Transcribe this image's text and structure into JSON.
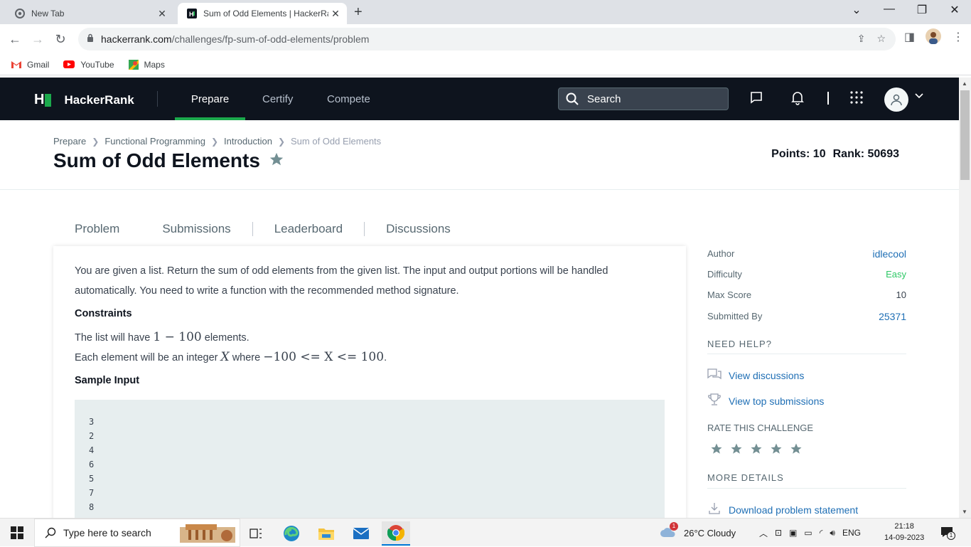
{
  "browser": {
    "tabs": [
      {
        "title": "New Tab",
        "active": false
      },
      {
        "title": "Sum of Odd Elements | HackerRa",
        "active": true
      }
    ],
    "url_host": "hackerrank.com",
    "url_path": "/challenges/fp-sum-of-odd-elements/problem",
    "bookmarks": [
      "Gmail",
      "YouTube",
      "Maps"
    ]
  },
  "header": {
    "brand": "HackerRank",
    "nav": [
      "Prepare",
      "Certify",
      "Compete"
    ],
    "active_nav": "Prepare",
    "search_placeholder": "Search"
  },
  "breadcrumb": [
    "Prepare",
    "Functional Programming",
    "Introduction",
    "Sum of Odd Elements"
  ],
  "title": "Sum of Odd Elements",
  "stats": {
    "points": "Points: 10",
    "rank": "Rank: 50693"
  },
  "tabs": [
    "Problem",
    "Submissions",
    "Leaderboard",
    "Discussions"
  ],
  "problem": {
    "description": "You are given a list. Return the sum of odd elements from the given list. The input and output portions will be handled automatically. You need to write a function with the recommended method signature.",
    "constraints_heading": "Constraints",
    "constraint1_pre": "The list will have",
    "constraint1_math": "1 − 100",
    "constraint1_post": "elements.",
    "constraint2_pre": "Each element will be an integer",
    "constraint2_var": "X",
    "constraint2_where": "where",
    "constraint2_math": "−100 <= X <= 100",
    "constraint2_post": ".",
    "sample_input_heading": "Sample Input",
    "sample_input": [
      "3",
      "2",
      "4",
      "6",
      "5",
      "7",
      "8"
    ]
  },
  "sidebar": {
    "author_label": "Author",
    "author": "idlecool",
    "difficulty_label": "Difficulty",
    "difficulty": "Easy",
    "max_score_label": "Max Score",
    "max_score": "10",
    "submitted_label": "Submitted By",
    "submitted": "25371",
    "need_help": "NEED HELP?",
    "view_discussions": "View discussions",
    "view_top": "View top submissions",
    "rate": "RATE THIS CHALLENGE",
    "more": "MORE DETAILS",
    "download": "Download problem statement"
  },
  "taskbar": {
    "search_placeholder": "Type here to search",
    "weather": "26°C  Cloudy",
    "lang": "ENG",
    "time": "21:18",
    "date": "14-09-2023",
    "weather_badge": "1",
    "notif_badge": "1"
  },
  "colors": {
    "accent_green": "#1ba94c",
    "link": "#1f6fb5",
    "header_bg": "#0e141e"
  }
}
